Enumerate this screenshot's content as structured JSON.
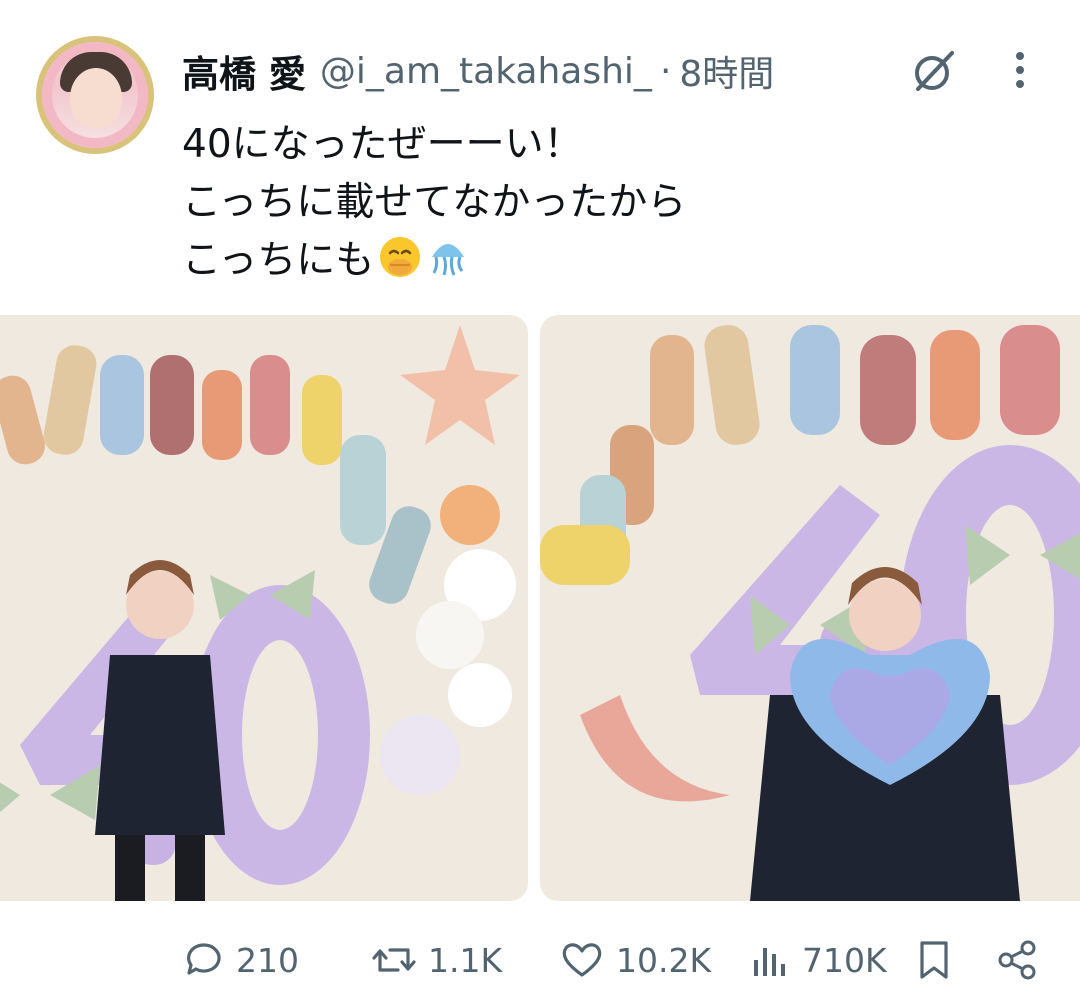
{
  "author": {
    "display_name": "高橋 愛",
    "handle": "@i_am_takahashi_",
    "separator": "·",
    "time": "8時間"
  },
  "tweet": {
    "lines": [
      "40になったぜーーい！",
      "こっちに載せてなかったから",
      "こっちにも"
    ],
    "emojis": [
      "hand-over-mouth-emoji",
      "jellyfish-emoji"
    ]
  },
  "media": {
    "count": 2,
    "photos": [
      {
        "alt": "photo-1"
      },
      {
        "alt": "photo-2"
      }
    ]
  },
  "actions": {
    "replies": "210",
    "reposts": "1.1K",
    "likes": "10.2K",
    "views": "710K"
  },
  "icons": {
    "grok": "grok-icon",
    "more": "more-options-icon",
    "reply": "reply-icon",
    "repost": "repost-icon",
    "like": "like-icon",
    "views": "views-icon",
    "bookmark": "bookmark-icon",
    "share": "share-icon"
  },
  "colors": {
    "text": "#0f1419",
    "muted": "#536471",
    "balloon_purple": "#cbb7e6",
    "balloon_green": "#b8ccb0"
  }
}
